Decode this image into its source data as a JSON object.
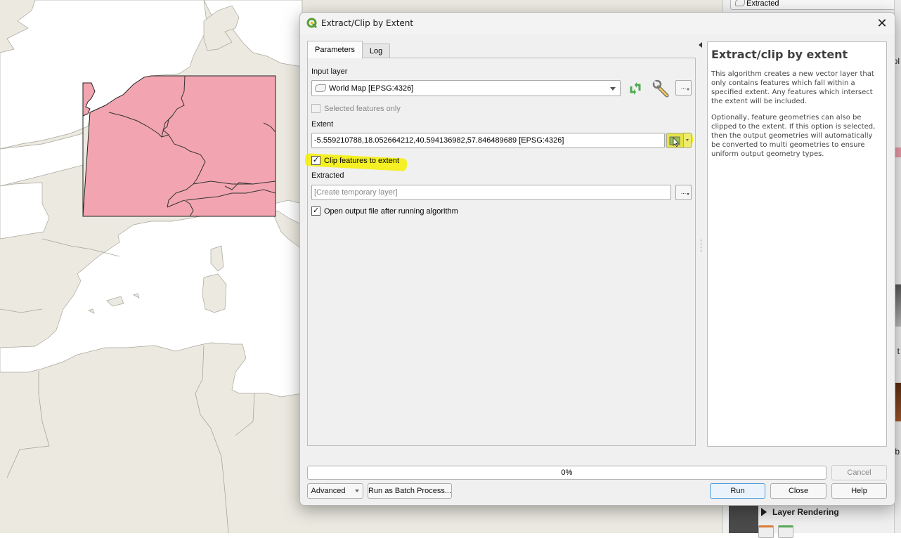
{
  "dialog": {
    "title": "Extract/Clip by Extent",
    "close_icon": "close-icon",
    "tabs": [
      {
        "label": "Parameters",
        "active": true
      },
      {
        "label": "Log",
        "active": false
      }
    ],
    "parameters": {
      "input_layer": {
        "label": "Input layer",
        "value": "World Map [EPSG:4326]",
        "icons": [
          "polygon-layer-icon",
          "iterate-icon",
          "wrench-icon",
          "more-options-button"
        ]
      },
      "selected_features_only": {
        "label": "Selected features only",
        "checked": false,
        "enabled": false
      },
      "extent": {
        "label": "Extent",
        "value": "-5.559210788,18.052664212,40.594136982,57.846489689 [EPSG:4326]",
        "tool_icon": "select-extent-on-canvas-icon"
      },
      "clip_features": {
        "label": "Clip features to extent",
        "checked": true
      },
      "extracted": {
        "label": "Extracted",
        "placeholder": "[Create temporary layer]",
        "browse_label": "..."
      },
      "open_output": {
        "label": "Open output file after running algorithm",
        "checked": true
      }
    },
    "help": {
      "title": "Extract/clip by extent",
      "paragraphs": [
        "This algorithm creates a new vector layer that only contains features which fall within a specified extent. Any features which intersect the extent will be included.",
        "Optionally, feature geometries can also be clipped to the extent. If this option is selected, then the output geometries will automatically be converted to multi geometries to ensure uniform output geometry types."
      ]
    },
    "progress": {
      "value": 0,
      "label": "0%"
    },
    "buttons": {
      "cancel": "Cancel",
      "advanced": "Advanced",
      "batch": "Run as Batch Process...",
      "run": "Run",
      "close": "Close",
      "help": "Help"
    },
    "more_label": "...",
    "check_mark": "✓"
  },
  "dock": {
    "layer_name": "Extracted",
    "section": "Layer Rendering",
    "fragments": [
      "pl",
      "t",
      "b"
    ]
  },
  "map": {
    "highlight_color": "#f2a5b0",
    "land_color": "#ebe9e0",
    "water_color": "#ffffff",
    "annotation_color": "#f5f000"
  }
}
